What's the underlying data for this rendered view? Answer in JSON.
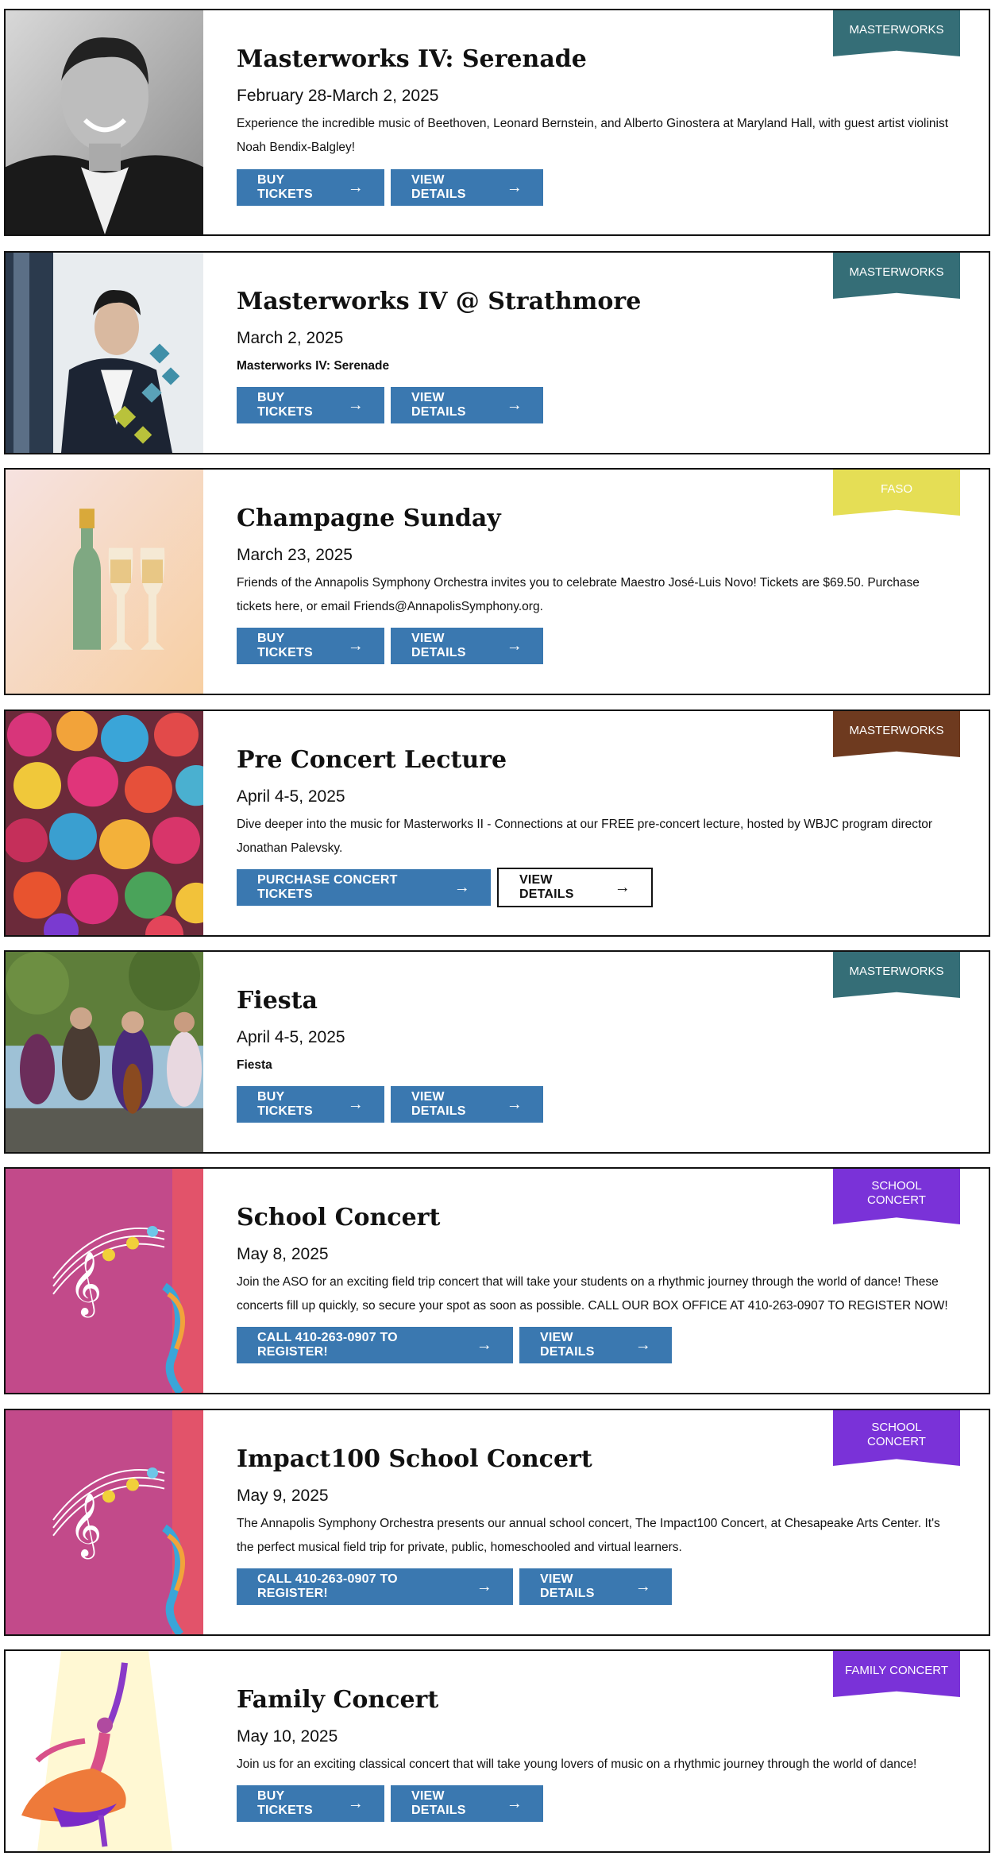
{
  "colors": {
    "button_blue": "#3a78b0",
    "masterworks_teal": "#356e77",
    "masterworks_brown": "#6e3a1f",
    "faso_yellow": "#e5de55",
    "school_purple": "#7a32d8"
  },
  "events": [
    {
      "badge": "MASTERWORKS",
      "title": "Masterworks IV: Serenade",
      "date": "February 28-March 2, 2025",
      "desc": "Experience the incredible music of Beethoven, Leonard Bernstein, and Alberto Ginostera at Maryland Hall, with guest artist violinist Noah Bendix-Balgley!",
      "btn1": "BUY TICKETS",
      "btn2": "VIEW DETAILS"
    },
    {
      "badge": "MASTERWORKS",
      "title": "Masterworks IV @ Strathmore",
      "date": "March 2, 2025",
      "desc": "Masterworks IV: Serenade",
      "btn1": "BUY TICKETS",
      "btn2": "VIEW DETAILS"
    },
    {
      "badge": "FASO",
      "title": "Champagne Sunday",
      "date": "March 23, 2025",
      "desc": "Friends of the Annapolis Symphony Orchestra invites you to celebrate Maestro José-Luis Novo! Tickets are $69.50. Purchase tickets here, or email Friends@AnnapolisSymphony.org.",
      "btn1": "BUY TICKETS",
      "btn2": "VIEW DETAILS"
    },
    {
      "badge": "MASTERWORKS",
      "title": "Pre Concert Lecture",
      "date": "April 4-5, 2025",
      "desc": "Dive deeper into the music for Masterworks II - Connections at our FREE pre-concert lecture, hosted by WBJC program director Jonathan Palevsky.",
      "btn1": "PURCHASE CONCERT TICKETS",
      "btn2": "VIEW DETAILS"
    },
    {
      "badge": "MASTERWORKS",
      "title": "Fiesta",
      "date": "April 4-5, 2025",
      "desc": "Fiesta",
      "btn1": "BUY TICKETS",
      "btn2": "VIEW DETAILS"
    },
    {
      "badge_line1": "SCHOOL",
      "badge_line2": "CONCERT",
      "title": "School Concert",
      "date": "May 8, 2025",
      "desc": "Join the ASO for an exciting field trip concert that will take your students on a rhythmic journey through the world of dance! These concerts fill up quickly, so secure your spot as soon as possible. CALL OUR BOX OFFICE AT 410-263-0907 TO REGISTER NOW!",
      "btn1": "CALL 410-263-0907 TO REGISTER!",
      "btn2": "VIEW DETAILS"
    },
    {
      "badge_line1": "SCHOOL",
      "badge_line2": "CONCERT",
      "title": "Impact100 School Concert",
      "date": "May 9, 2025",
      "desc": "The Annapolis Symphony Orchestra presents our annual school concert, The Impact100 Concert, at Chesapeake Arts Center. It's the perfect musical field trip for private, public, homeschooled and virtual learners.",
      "btn1": "CALL 410-263-0907 TO REGISTER!",
      "btn2": "VIEW DETAILS"
    },
    {
      "badge": "FAMILY CONCERT",
      "title": "Family Concert",
      "date": "May 10, 2025",
      "desc": "Join us for an exciting classical concert that will take young lovers of music on a rhythmic journey through the world of dance!",
      "btn1": "BUY TICKETS",
      "btn2": "VIEW DETAILS"
    }
  ],
  "arrow_glyph": "→"
}
